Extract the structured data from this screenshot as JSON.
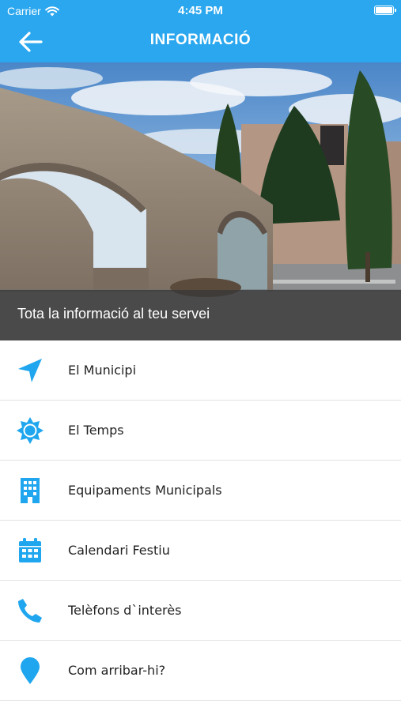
{
  "status_bar": {
    "carrier": "Carrier",
    "time": "4:45 PM"
  },
  "navbar": {
    "title": "INFORMACIÓ",
    "back_icon": "arrow-left-icon"
  },
  "hero": {
    "caption": "Tota la informació al teu servei"
  },
  "colors": {
    "accent": "#2aa7ee",
    "icon": "#1fa6ee",
    "caption_bg": "#373737"
  },
  "menu": {
    "items": [
      {
        "label": "El Municipi",
        "icon": "location-arrow-icon"
      },
      {
        "label": "El Temps",
        "icon": "sun-icon"
      },
      {
        "label": "Equipaments Municipals",
        "icon": "building-icon"
      },
      {
        "label": "Calendari Festiu",
        "icon": "calendar-icon"
      },
      {
        "label": "Telèfons d`interès",
        "icon": "phone-icon"
      },
      {
        "label": "Com arribar-hi?",
        "icon": "map-pin-icon"
      }
    ]
  }
}
